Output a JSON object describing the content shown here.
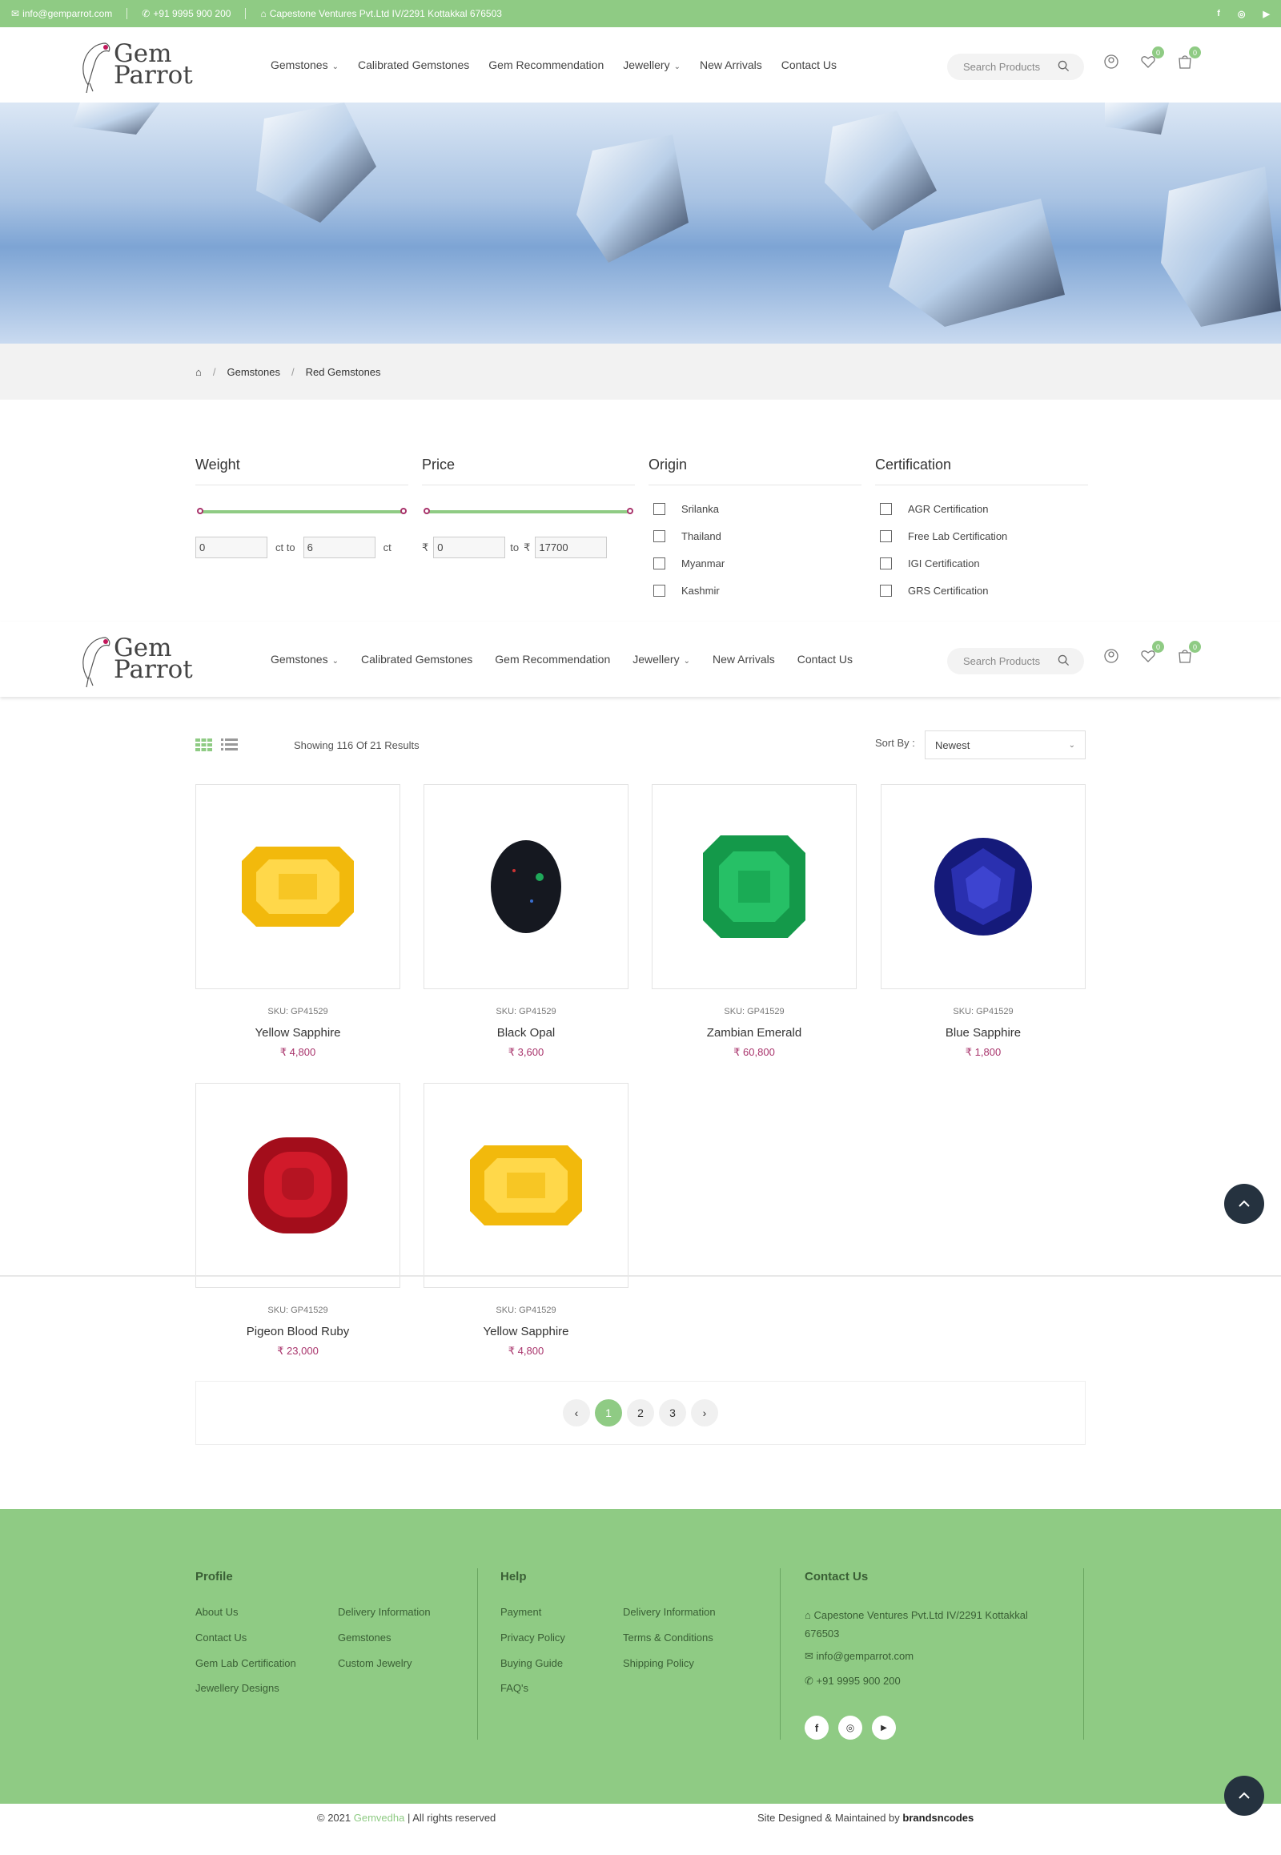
{
  "topbar": {
    "email": "info@gemparrot.com",
    "phone": "+91 9995 900 200",
    "address": "Capestone Ventures Pvt.Ltd IV/2291 Kottakkal 676503",
    "social": [
      "f",
      "ig",
      "yt"
    ]
  },
  "header": {
    "logo_line1": "Gem",
    "logo_line2": "Parrot",
    "nav": [
      {
        "label": "Gemstones",
        "dropdown": true
      },
      {
        "label": "Calibrated Gemstones",
        "dropdown": false
      },
      {
        "label": "Gem Recommendation",
        "dropdown": false
      },
      {
        "label": "Jewellery",
        "dropdown": true
      },
      {
        "label": "New Arrivals",
        "dropdown": false
      },
      {
        "label": "Contact Us",
        "dropdown": false
      }
    ],
    "search_placeholder": "Search Products",
    "wishlist_count": "0",
    "cart_count": "0"
  },
  "breadcrumb": {
    "items": [
      "Gemstones",
      "Red Gemstones"
    ]
  },
  "filters": {
    "weight": {
      "title": "Weight",
      "min": "0",
      "max": "6",
      "mid_label": "ct to",
      "unit": "ct"
    },
    "price": {
      "title": "Price",
      "min": "0",
      "max": "17700",
      "currency": "₹",
      "to_label": "to"
    },
    "origin": {
      "title": "Origin",
      "options": [
        "Srilanka",
        "Thailand",
        "Myanmar",
        "Kashmir"
      ]
    },
    "certification": {
      "title": "Certification",
      "options": [
        "AGR Certification",
        "Free Lab Certification",
        "IGI Certification",
        "GRS Certification"
      ]
    }
  },
  "toolbar": {
    "results_text": "Showing 116 Of 21 Results",
    "sort_label": "Sort By :",
    "sort_value": "Newest"
  },
  "products": [
    {
      "sku": "SKU: GP41529",
      "name": "Yellow Sapphire",
      "price": "₹ 4,800",
      "color": "#f2b90c",
      "shape": "emerald-cut"
    },
    {
      "sku": "SKU: GP41529",
      "name": "Black Opal",
      "price": "₹ 3,600",
      "color": "#151820",
      "shape": "oval"
    },
    {
      "sku": "SKU: GP41529",
      "name": "Zambian Emerald",
      "price": "₹ 60,800",
      "color": "#18a84a",
      "shape": "emerald-cut"
    },
    {
      "sku": "SKU: GP41529",
      "name": "Blue Sapphire",
      "price": "₹ 1,800",
      "color": "#1a1f8c",
      "shape": "round"
    },
    {
      "sku": "SKU: GP41529",
      "name": "Pigeon Blood Ruby",
      "price": "₹ 23,000",
      "color": "#b0101e",
      "shape": "cushion"
    },
    {
      "sku": "SKU: GP41529",
      "name": "Yellow Sapphire",
      "price": "₹ 4,800",
      "color": "#f2b90c",
      "shape": "emerald-cut"
    }
  ],
  "pagination": {
    "pages": [
      "1",
      "2",
      "3"
    ],
    "current": "1"
  },
  "footer": {
    "profile": {
      "title": "Profile",
      "links": [
        "About Us",
        "Delivery Information",
        "Contact Us",
        "Gemstones",
        "Gem Lab Certification",
        "Custom Jewelry",
        "Jewellery Designs"
      ]
    },
    "help": {
      "title": "Help",
      "links": [
        "Payment",
        "Delivery Information",
        "Privacy Policy",
        "Terms & Conditions",
        "Buying Guide",
        "Shipping Policy",
        "FAQ's"
      ]
    },
    "contact": {
      "title": "Contact Us",
      "address": "Capestone Ventures Pvt.Ltd IV/2291 Kottakkal 676503",
      "email": "info@gemparrot.com",
      "phone": "+91 9995 900 200"
    },
    "copyright_pre": "© 2021",
    "copyright_brand": "Gemvedha",
    "copyright_post": "| All rights reserved",
    "designed_by_pre": "Site Designed & Maintained by",
    "designed_by_brand": "brandsncodes"
  },
  "colors": {
    "brand_green": "#8fcb84",
    "price_magenta": "#a8336b",
    "dark_button": "#25323f"
  }
}
